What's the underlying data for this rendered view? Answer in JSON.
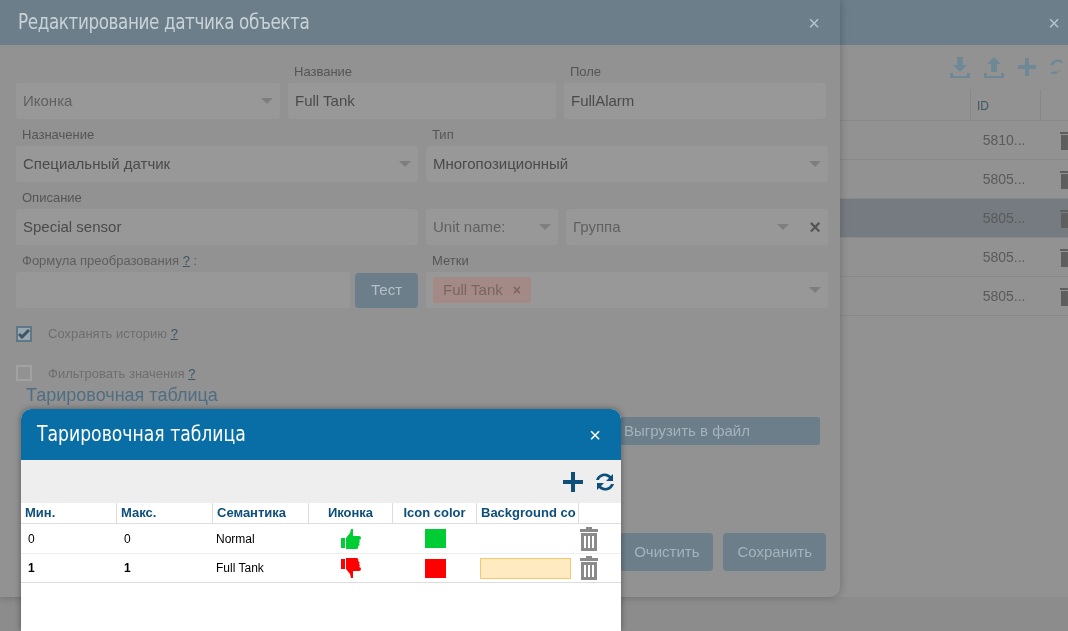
{
  "back_window": {
    "close": "×",
    "table": {
      "columns": [
        "ID"
      ],
      "rows": [
        {
          "id": "5810...",
          "selected": false
        },
        {
          "id": "5805...",
          "selected": false
        },
        {
          "id": "5805...",
          "selected": true
        },
        {
          "id": "5805...",
          "selected": false
        },
        {
          "id": "5805...",
          "selected": false
        }
      ]
    }
  },
  "dialog": {
    "title": "Редактирование датчика объекта",
    "close": "×",
    "icon_select": {
      "placeholder": "Иконка"
    },
    "name": {
      "label": "Название",
      "value": "Full Tank"
    },
    "field": {
      "label": "Поле",
      "value": "FullAlarm"
    },
    "purpose": {
      "label": "Назначение",
      "value": "Специальный датчик"
    },
    "type": {
      "label": "Тип",
      "value": "Многопозиционный"
    },
    "description": {
      "label": "Описание",
      "value": "Special sensor"
    },
    "unit_select": {
      "placeholder": "Unit name:"
    },
    "group_select": {
      "placeholder": "Группа",
      "clear": "×"
    },
    "formula": {
      "label": "Формула преобразования",
      "help": "?",
      "suffix": ":"
    },
    "test_button": "Тест",
    "tags": {
      "label": "Метки",
      "items": [
        {
          "text": "Full Tank",
          "remove": "×"
        }
      ]
    },
    "checkboxes": [
      {
        "label": "Сохранять историю",
        "help": "?",
        "checked": true
      },
      {
        "label": "Фильтровать значения",
        "help": "?",
        "checked": false
      }
    ],
    "section_title": "Тарировочная таблица",
    "export_button": "Выгрузить в файл",
    "footer_buttons": [
      "Очистить",
      "Сохранить"
    ]
  },
  "popup": {
    "title": "Тарировочная таблица",
    "close": "×",
    "columns": [
      "Мин.",
      "Макс.",
      "Семантика",
      "Иконка",
      "Icon color",
      "Background co"
    ],
    "rows": [
      {
        "min": "0",
        "max": "0",
        "semantics": "Normal",
        "kind": "up",
        "color": "#00cc33",
        "highlighted": false,
        "emphasized": false
      },
      {
        "min": "1",
        "max": "1",
        "semantics": "Full Tank",
        "kind": "down",
        "color": "#ff0000",
        "highlighted": true,
        "emphasized": true
      }
    ]
  }
}
